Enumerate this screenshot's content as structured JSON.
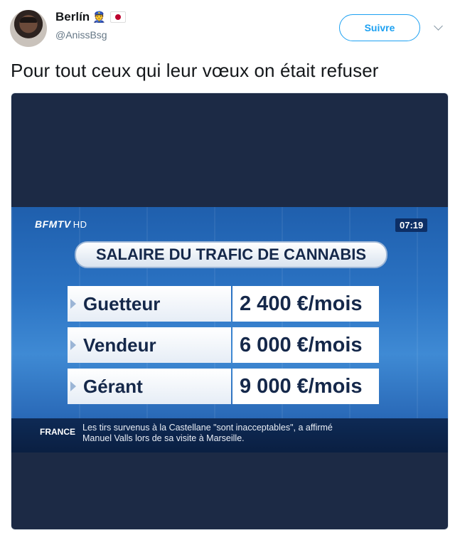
{
  "user": {
    "display_name": "Berlín",
    "handle": "@AnissBsg",
    "emoji": "👮"
  },
  "follow_label": "Suivre",
  "tweet_text": "Pour tout ceux qui leur vœux on était refuser",
  "tv": {
    "channel": "BFMTV",
    "channel_quality": "HD",
    "time": "07:19",
    "title": "SALAIRE DU TRAFIC DE CANNABIS",
    "rows": [
      {
        "role": "Guetteur",
        "salary": "2 400 €/mois"
      },
      {
        "role": "Vendeur",
        "salary": "6 000 €/mois"
      },
      {
        "role": "Gérant",
        "salary": "9 000 €/mois"
      }
    ],
    "ticker_region": "FRANCE",
    "ticker_text": "Les tirs survenus à la Castellane \"sont inacceptables\", a affirmé Manuel Valls lors de sa visite à Marseille."
  },
  "colors": {
    "accent": "#1da1f2",
    "tv_blue": "#2b73c3",
    "navy": "#15284a"
  }
}
